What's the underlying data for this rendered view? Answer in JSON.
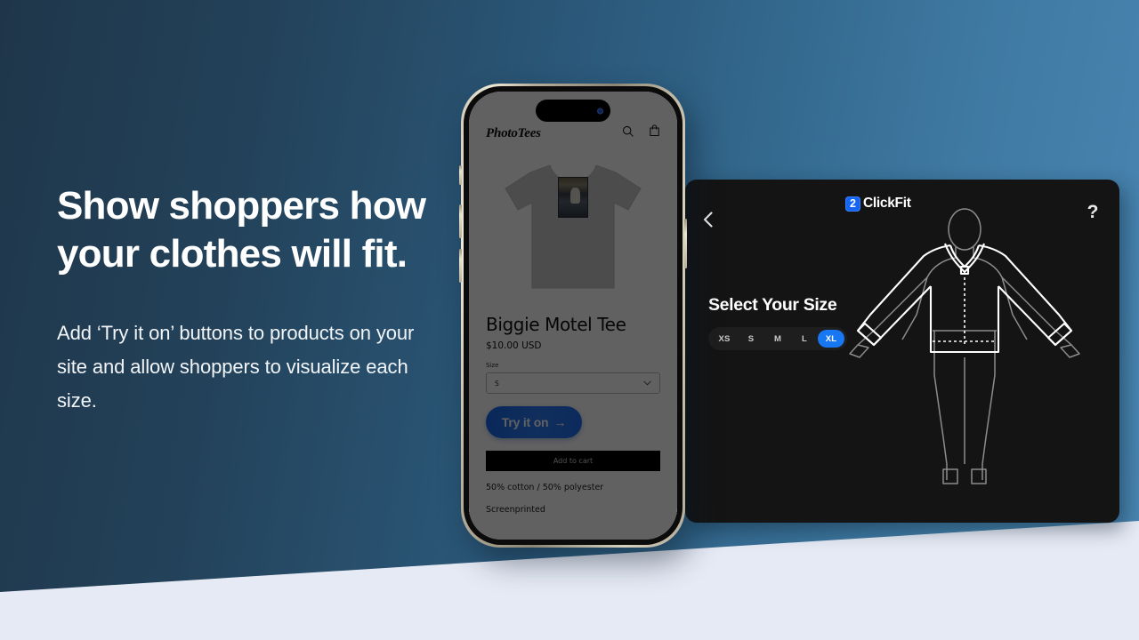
{
  "background": {
    "gradient_from": "#1f364a",
    "gradient_to": "#4a86b2",
    "wedge_color": "#e6eaf5"
  },
  "marketing": {
    "headline": "Show shoppers how your clothes will fit.",
    "subcopy": "Add ‘Try it on’ buttons to products on your site and allow shoppers to visualize each size."
  },
  "phone": {
    "store": {
      "logo": "PhotoTees",
      "search_icon": "search-icon",
      "cart_icon": "shopping-bag-icon"
    },
    "product": {
      "title": "Biggie Motel Tee",
      "price": "$10.00 USD",
      "size_label": "Size",
      "size_value": "S",
      "size_chevron_icon": "chevron-down-icon",
      "tryon_label": "Try it on",
      "tryon_arrow": "→",
      "addcart_label": "Add to cart",
      "meta_material": "50% cotton / 50% polyester",
      "meta_print": "Screenprinted"
    }
  },
  "clickfit": {
    "back_icon": "chevron-left-icon",
    "logo_mark": "2",
    "logo_text": "ClickFit",
    "help_icon": "?",
    "select_title": "Select Your Size",
    "sizes": [
      {
        "label": "XS",
        "selected": false
      },
      {
        "label": "S",
        "selected": false
      },
      {
        "label": "M",
        "selected": false
      },
      {
        "label": "L",
        "selected": false
      },
      {
        "label": "XL",
        "selected": true
      }
    ],
    "accent_color": "#1877f2",
    "panel_color": "#141414",
    "figure": {
      "name": "mannequin-fit-preview",
      "mannequin_stroke": "#8c8c8c",
      "garment_stroke": "#ffffff",
      "measure_stroke": "#ffffff"
    }
  }
}
